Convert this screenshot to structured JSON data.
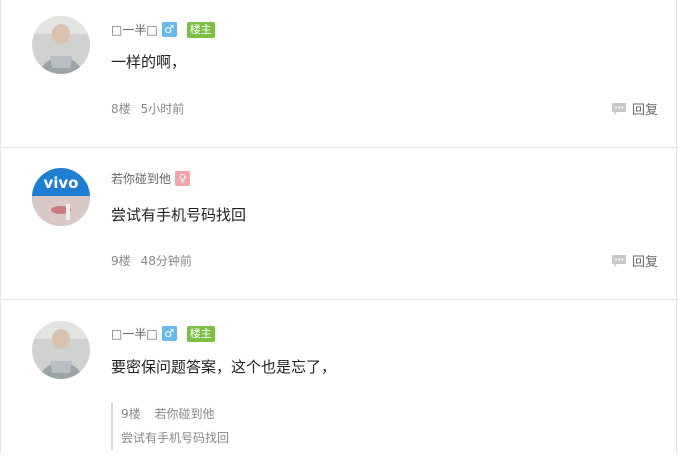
{
  "posts": [
    {
      "username": "□一半□",
      "gender_symbol": "♂",
      "op_badge": "楼主",
      "content": "一样的啊，",
      "floor": "8楼",
      "time": "5小时前",
      "reply_label": "回复"
    },
    {
      "username": "若你碰到他",
      "gender_symbol": "♀",
      "content": "尝试有手机号码找回",
      "floor": "9楼",
      "time": "48分钟前",
      "reply_label": "回复",
      "avatar_text": "vivo"
    },
    {
      "username": "□一半□",
      "gender_symbol": "♂",
      "op_badge": "楼主",
      "content": "要密保问题答案，这个也是忘了，",
      "quote": {
        "floor": "9楼",
        "author": "若你碰到他",
        "text": "尝试有手机号码找回"
      }
    }
  ],
  "colors": {
    "male": "#6ab8e6",
    "female": "#f4a3a8",
    "op_badge": "#7bc043",
    "divider": "#e6e6e6"
  }
}
